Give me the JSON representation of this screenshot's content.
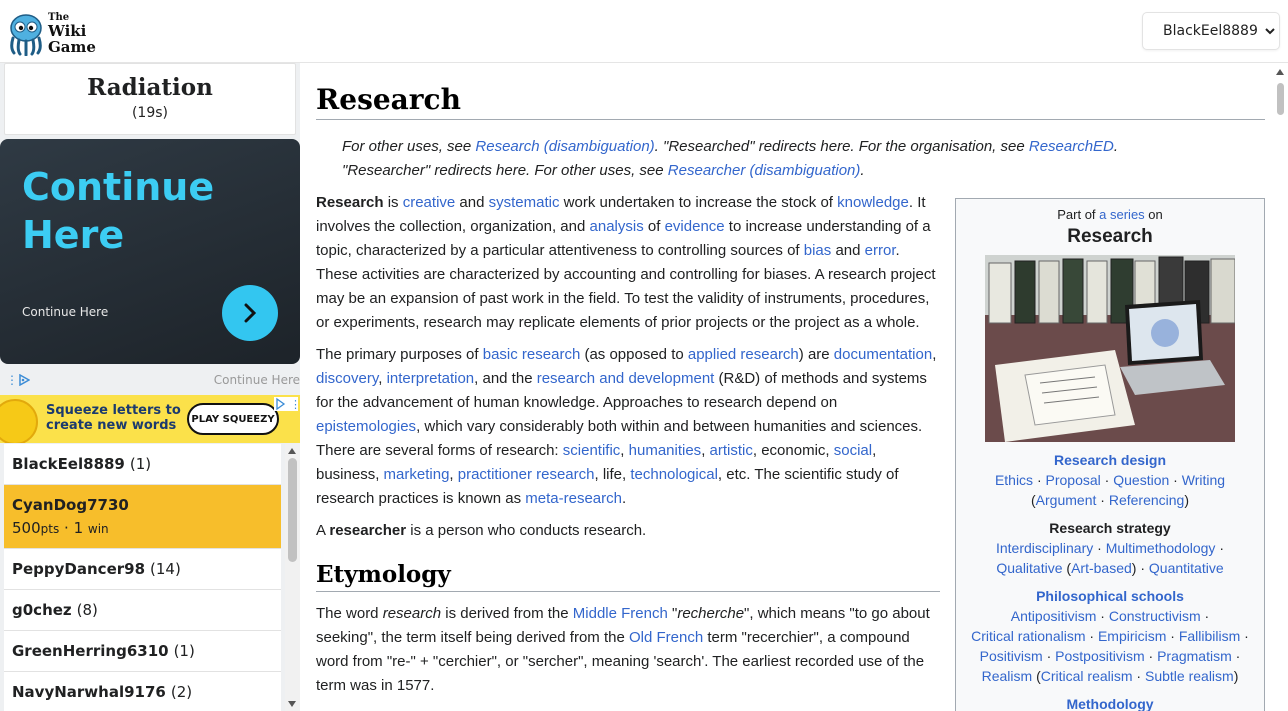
{
  "header": {
    "logo_the": "The",
    "logo_wiki": "Wiki",
    "logo_game": "Game",
    "user_name": "BlackEel8889"
  },
  "target": {
    "title": "Radiation",
    "timer": "(19s)"
  },
  "ads": {
    "ad1_headline_1": "Continue",
    "ad1_headline_2": "Here",
    "ad1_sub": "Continue Here",
    "bar_link": "Continue Here",
    "ad2_line_1": "Squeeze letters to",
    "ad2_line_2": "create new words",
    "ad2_button": "PLAY SQUEEZY"
  },
  "players": [
    {
      "name": "BlackEel8889",
      "count": "(1)"
    },
    {
      "name": "CyanDog7730",
      "points": "500",
      "pts_label": "pts",
      "sep": "·",
      "wins": "1",
      "win_label": "win"
    },
    {
      "name": "PeppyDancer98",
      "count": "(14)"
    },
    {
      "name": "g0chez",
      "count": "(8)"
    },
    {
      "name": "GreenHerring6310",
      "count": "(1)"
    },
    {
      "name": "NavyNarwhal9176",
      "count": "(2)"
    }
  ],
  "article": {
    "title": "Research",
    "hatnote": {
      "t1": "For other uses, see ",
      "l1": "Research (disambiguation)",
      "t2": ". \"Researched\" redirects here. For the organisation, see ",
      "l2": "ResearchED",
      "t3": ".",
      "t4": "\"Researcher\" redirects here. For other uses, see ",
      "l3": "Researcher (disambiguation)",
      "t5": "."
    },
    "p1": {
      "b1": "Research",
      "t1": " is ",
      "l1": "creative",
      "t2": " and ",
      "l2": "systematic",
      "t3": " work undertaken to increase the stock of ",
      "l3": "knowledge",
      "t4": ". It involves the collection, organization, and ",
      "l4": "analysis",
      "t5": " of ",
      "l5": "evidence",
      "t6": " to increase understanding of a topic, characterized by a particular attentiveness to controlling sources of ",
      "l6": "bias",
      "t7": " and ",
      "l7": "error",
      "t8": ". These activities are characterized by accounting and controlling for biases. A research project may be an expansion of past work in the field. To test the validity of instruments, procedures, or experiments, research may replicate elements of prior projects or the project as a whole."
    },
    "p2": {
      "t1": "The primary purposes of ",
      "l1": "basic research",
      "t2": " (as opposed to ",
      "l2": "applied research",
      "t3": ") are ",
      "l3": "documentation",
      "t4": ", ",
      "l4": "discovery",
      "t5": ", ",
      "l5": "interpretation",
      "t6": ", and the ",
      "l6": "research and development",
      "t7": " (R&D) of methods and systems for the advancement of human knowledge. Approaches to research depend on ",
      "l7": "epistemologies",
      "t8": ", which vary considerably both within and between humanities and sciences. There are several forms of research: ",
      "l8": "scientific",
      "t9": ", ",
      "l9": "humanities",
      "t10": ", ",
      "l10": "artistic",
      "t11": ", economic, ",
      "l11": "social",
      "t12": ", business, ",
      "l12": "marketing",
      "t13": ", ",
      "l13": "practitioner research",
      "t14": ", life, ",
      "l14": "technological",
      "t15": ", etc. The scientific study of research practices is known as ",
      "l15": "meta-research",
      "t16": "."
    },
    "p3": {
      "t1": "A ",
      "b1": "researcher",
      "t2": " is a person who conducts research."
    },
    "h2_etymology": "Etymology",
    "p4": {
      "t1": "The word ",
      "i1": "research",
      "t2": " is derived from the ",
      "l1": "Middle French",
      "t3": " \"",
      "i2": "recherche",
      "t4": "\", which means \"to go about seeking\", the term itself being derived from the ",
      "l2": "Old French",
      "t5": " term \"recerchier\", a compound word from \"re-\" + \"cerchier\", or \"sercher\", meaning 'search'. The earliest recorded use of the term was in 1577."
    }
  },
  "infobox": {
    "part_of": "Part of ",
    "series_link": "a series",
    "on": " on",
    "title": "Research",
    "sec1_head": "Research design",
    "sec1_items": [
      "Ethics",
      "Proposal",
      "Question",
      "Writing"
    ],
    "sec1_paren": [
      "Argument",
      "Referencing"
    ],
    "sec2_head": "Research strategy",
    "sec2_items": [
      "Interdisciplinary",
      "Multimethodology",
      "Qualitative",
      "Art-based",
      "Quantitative"
    ],
    "sec3_head": "Philosophical schools",
    "sec3_items": [
      "Antipositivism",
      "Constructivism",
      "Critical rationalism",
      "Empiricism",
      "Fallibilism",
      "Positivism",
      "Postpositivism",
      "Pragmatism",
      "Realism",
      "Critical realism",
      "Subtle realism"
    ],
    "sec4_head": "Methodology",
    "dot": " · "
  },
  "colors": {
    "link": "#3366cc",
    "active_player": "#f7be2b",
    "ad_accent": "#33c6f0"
  }
}
